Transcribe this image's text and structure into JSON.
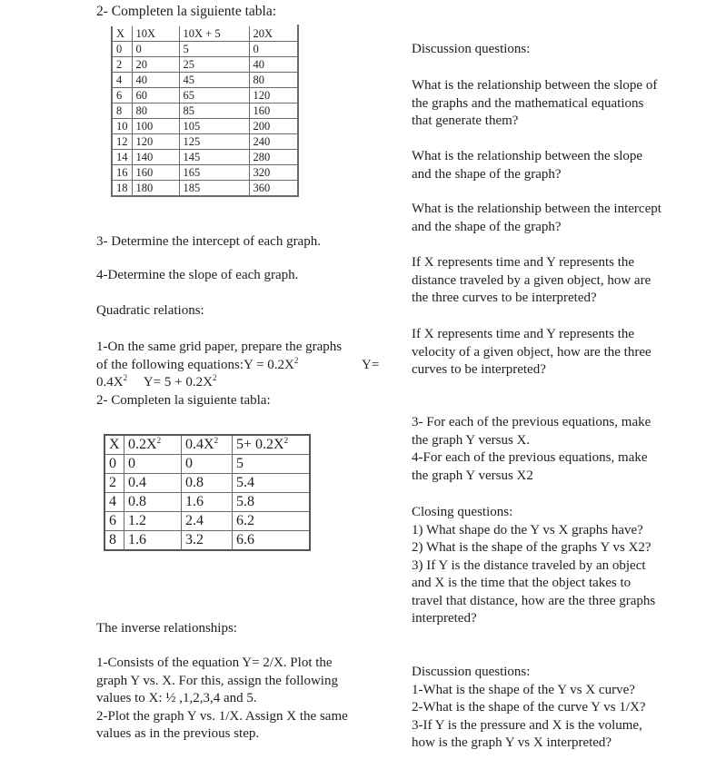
{
  "left_column": {
    "table1_heading": "2- Completen la siguiente tabla:",
    "table1": {
      "headers": [
        "X",
        "10X",
        "10X + 5",
        "20X"
      ],
      "rows": [
        [
          "0",
          "0",
          "5",
          "0"
        ],
        [
          "2",
          "20",
          "25",
          "40"
        ],
        [
          "4",
          "40",
          "45",
          "80"
        ],
        [
          "6",
          "60",
          "65",
          "120"
        ],
        [
          "8",
          "80",
          "85",
          "160"
        ],
        [
          "10",
          "100",
          "105",
          "200"
        ],
        [
          "12",
          "120",
          "125",
          "240"
        ],
        [
          "14",
          "140",
          "145",
          "280"
        ],
        [
          "16",
          "160",
          "165",
          "320"
        ],
        [
          "18",
          "180",
          "185",
          "360"
        ]
      ]
    },
    "step3": "3- Determine the intercept of each graph.",
    "step4": "4-Determine the slope of each graph.",
    "quadratic_heading": "Quadratic relations:",
    "quadratic_step1_line1": "1-On the same grid paper, prepare the graphs",
    "quadratic_step1_line2a": "of the following equations:Y = 0.2X",
    "quadratic_step1_line2b": "Y=",
    "quadratic_step1_line3a": "0.4X",
    "quadratic_step1_line3b": "Y= 5 + 0.2X",
    "superscript_2": "2",
    "table2_heading": "2- Completen la siguiente tabla:",
    "table2": {
      "headers": [
        {
          "base": "X",
          "sup": ""
        },
        {
          "base": "0.2X",
          "sup": "2"
        },
        {
          "base": "0.4X",
          "sup": "2"
        },
        {
          "base": "5+ 0.2X",
          "sup": "2"
        }
      ],
      "rows": [
        [
          "0",
          "0",
          "0",
          "5"
        ],
        [
          "2",
          "0.4",
          "0.8",
          "5.4"
        ],
        [
          "4",
          "0.8",
          "1.6",
          "5.8"
        ],
        [
          "6",
          "1.2",
          "2.4",
          "6.2"
        ],
        [
          "8",
          "1.6",
          "3.2",
          "6.6"
        ]
      ]
    },
    "inverse_heading": "The inverse relationships:",
    "inverse_lines": [
      "1-Consists of the equation Y= 2/X. Plot the",
      "graph Y vs. X. For this, assign the following",
      "values to X: ½ ,1,2,3,4 and 5.",
      "2-Plot the graph Y vs. 1/X. Assign X the same",
      "values as in the previous step."
    ]
  },
  "right_column": {
    "discussion1_heading": "Discussion questions:",
    "q1_lines": [
      "What is the relationship between the slope of",
      "the graphs and the mathematical equations",
      "that generate them?"
    ],
    "q2_lines": [
      "What is the relationship between the slope",
      "and the shape of the graph?"
    ],
    "q3_lines": [
      "What is the relationship between the intercept",
      "and the shape of the graph?"
    ],
    "q4_lines": [
      "If X represents time and Y represents the",
      "distance traveled by a given object, how are",
      "the three curves to be interpreted?"
    ],
    "q5_lines": [
      "If X represents time and Y represents the",
      "velocity of a given object, how are the three",
      "curves to be interpreted?"
    ],
    "steps_lines": [
      "3- For each of the previous equations, make",
      "the graph Y versus X.",
      "4-For each of the previous equations, make",
      "the graph Y versus X2"
    ],
    "closing_lines": [
      "Closing questions:",
      "1) What shape do the Y vs X graphs have?",
      "2) What is the shape of the graphs Y vs X2?",
      "3) If Y is the distance traveled by an object",
      "and X is the time that the object takes to",
      "travel that distance, how are the three graphs",
      "interpreted?"
    ],
    "discussion2_lines": [
      "Discussion questions:",
      "1-What is the shape of the Y vs X curve?",
      "2-What is the shape of the curve Y vs 1/X?",
      "3-If Y is the pressure and X is the volume,",
      "how is the graph Y vs X interpreted?"
    ]
  }
}
